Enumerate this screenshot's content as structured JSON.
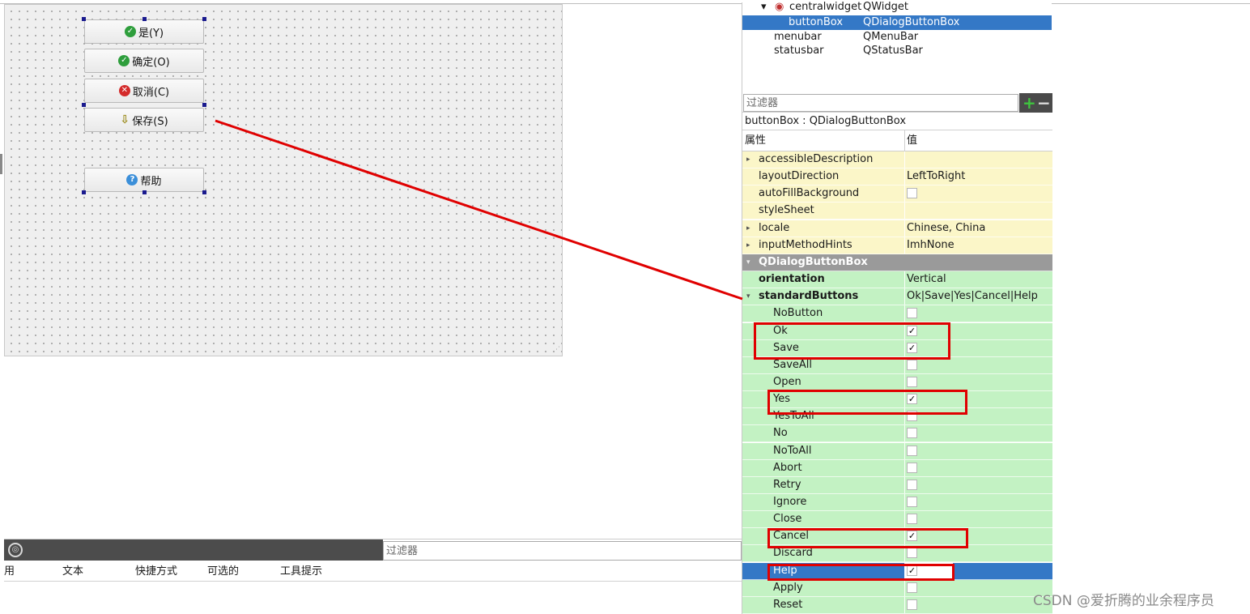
{
  "form_buttons": [
    {
      "label": "是(Y)",
      "icon": "check-circle-icon"
    },
    {
      "label": "确定(O)",
      "icon": "check-circle-icon"
    },
    {
      "label": "取消(C)",
      "icon": "cancel-circle-icon"
    },
    {
      "label": "保存(S)",
      "icon": "save-arrow-icon"
    },
    {
      "label": "帮助",
      "icon": "help-circle-icon"
    }
  ],
  "object_tree": {
    "rows": [
      {
        "name": "centralwidget",
        "class": "QWidget"
      },
      {
        "name": "buttonBox",
        "class": "QDialogButtonBox",
        "selected": true
      },
      {
        "name": "menubar",
        "class": "QMenuBar"
      },
      {
        "name": "statusbar",
        "class": "QStatusBar"
      }
    ]
  },
  "property_editor": {
    "filter_placeholder": "过滤器",
    "object_caption": "buttonBox : QDialogButtonBox",
    "header_property": "属性",
    "header_value": "值",
    "rows": [
      {
        "name": "accessibleDescription",
        "value": "",
        "expandable": true
      },
      {
        "name": "layoutDirection",
        "value": "LeftToRight"
      },
      {
        "name": "autoFillBackground",
        "checked": false
      },
      {
        "name": "styleSheet",
        "value": ""
      },
      {
        "name": "locale",
        "value": "Chinese, China",
        "expandable": true
      },
      {
        "name": "inputMethodHints",
        "value": "ImhNone",
        "expandable": true
      },
      {
        "name": "QDialogButtonBox",
        "section": true
      },
      {
        "name": "orientation",
        "value": "Vertical"
      },
      {
        "name": "standardButtons",
        "value": "Ok|Save|Yes|Cancel|Help",
        "expanded": true
      },
      {
        "name": "NoButton",
        "checked": false
      },
      {
        "name": "Ok",
        "checked": true
      },
      {
        "name": "Save",
        "checked": true
      },
      {
        "name": "SaveAll",
        "checked": false
      },
      {
        "name": "Open",
        "checked": false
      },
      {
        "name": "Yes",
        "checked": true
      },
      {
        "name": "YesToAll",
        "checked": false
      },
      {
        "name": "No",
        "checked": false
      },
      {
        "name": "NoToAll",
        "checked": false
      },
      {
        "name": "Abort",
        "checked": false
      },
      {
        "name": "Retry",
        "checked": false
      },
      {
        "name": "Ignore",
        "checked": false
      },
      {
        "name": "Close",
        "checked": false
      },
      {
        "name": "Cancel",
        "checked": true
      },
      {
        "name": "Discard",
        "checked": false
      },
      {
        "name": "Help",
        "checked": true,
        "selected": true
      },
      {
        "name": "Apply",
        "checked": false
      },
      {
        "name": "Reset",
        "checked": false
      }
    ]
  },
  "action_editor": {
    "filter_placeholder": "过滤器",
    "columns": [
      "用",
      "文本",
      "快捷方式",
      "可选的",
      "工具提示"
    ]
  },
  "colors": {
    "highlight": "#e00000",
    "selection": "#3478c6",
    "property_green": "#c3f2c3",
    "property_yellow": "#fbf6c8"
  },
  "watermark": "CSDN @爱折腾的业余程序员"
}
